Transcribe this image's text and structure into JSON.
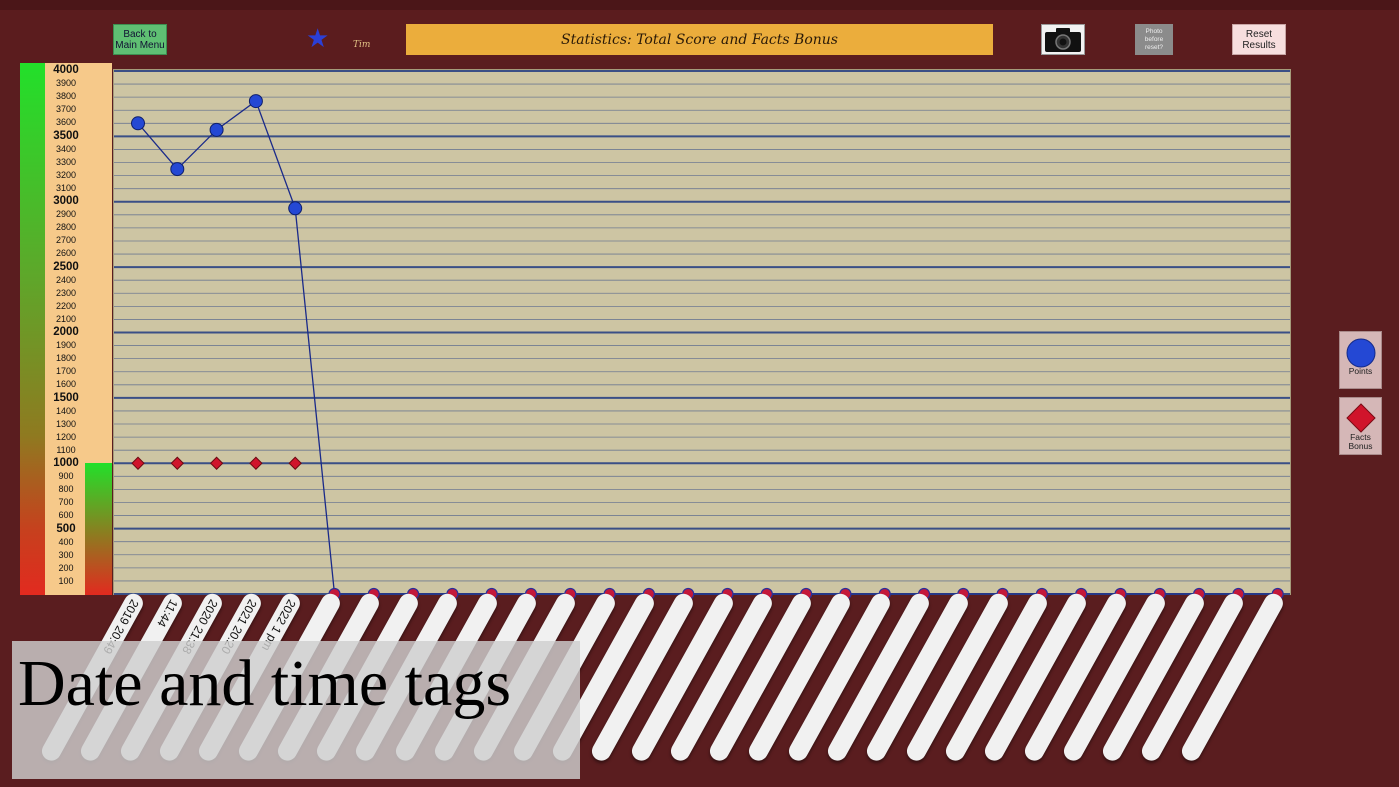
{
  "header": {
    "back_button": "Back to\nMain Menu",
    "player_name": "Tim",
    "title": "Statistics: Total Score and Facts Bonus",
    "photo_button": "Photo\nbefore\nreset?",
    "reset_button": "Reset\nResults"
  },
  "scale": {
    "major_ticks": [
      "4000",
      "3500",
      "3000",
      "2500",
      "2000",
      "1500",
      "1000",
      "500"
    ],
    "minor_ticks": [
      "3900",
      "3800",
      "3700",
      "3600",
      "3400",
      "3300",
      "3200",
      "3100",
      "2900",
      "2800",
      "2700",
      "2600",
      "2400",
      "2300",
      "2200",
      "2100",
      "1900",
      "1800",
      "1700",
      "1600",
      "1400",
      "1300",
      "1200",
      "1100",
      "900",
      "800",
      "700",
      "600",
      "400",
      "300",
      "200",
      "100"
    ]
  },
  "legend": {
    "points_label": "Points",
    "facts_label": "Facts\nBonus"
  },
  "tags": {
    "count": 30,
    "visible_text": [
      "2019\n20:49",
      "11:44",
      "2020\n21:38",
      "2021\n20:20",
      "2022\n1 pm"
    ]
  },
  "overlay_caption": "Date and time tags",
  "colors": {
    "points": "#2448d4",
    "facts": "#d0142b",
    "line": "#1a2a8a",
    "plot_bg": "#cdc5a3",
    "title_bg": "#ebad3c"
  },
  "chart_data": {
    "type": "line",
    "ylim": [
      0,
      4000
    ],
    "series": [
      {
        "name": "Points",
        "values": [
          3600,
          3250,
          3550,
          3770,
          2950,
          0,
          0,
          0,
          0,
          0,
          0,
          0,
          0,
          0,
          0,
          0,
          0,
          0,
          0,
          0,
          0,
          0,
          0,
          0,
          0,
          0,
          0,
          0,
          0,
          0
        ]
      },
      {
        "name": "Facts Bonus",
        "values": [
          1000,
          1000,
          1000,
          1000,
          1000
        ]
      }
    ]
  }
}
